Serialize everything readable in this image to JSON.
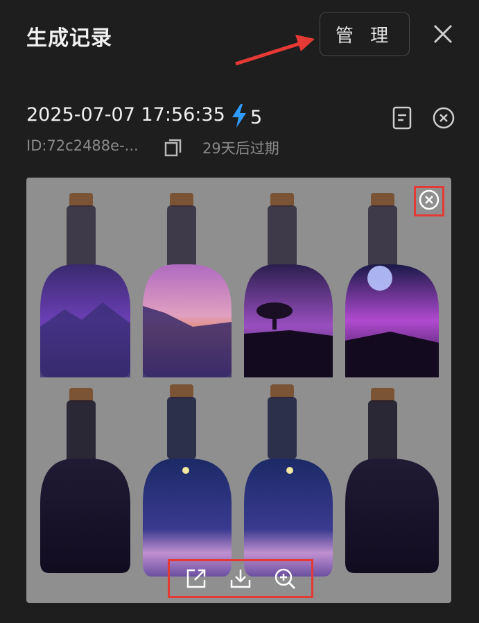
{
  "header": {
    "title": "生成记录",
    "manage_label": "管 理",
    "close_icon": "close-icon"
  },
  "record": {
    "timestamp": "2025-07-07 17:56:35",
    "credits": "5",
    "id": "ID:72c2488e-...",
    "expiry": "29天后过期"
  },
  "image_tools": [
    "share-icon",
    "download-icon",
    "zoom-in-icon"
  ],
  "colors": {
    "background": "#1e1e1e",
    "accent_lightning": "#2f9bff",
    "highlight_box": "#e53935"
  }
}
